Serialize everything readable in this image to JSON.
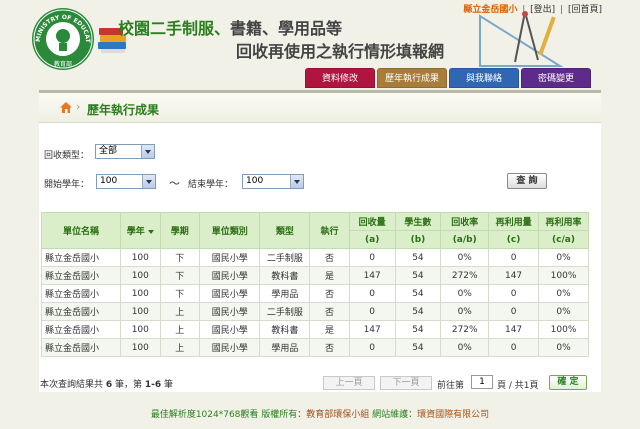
{
  "header": {
    "title_part1": "校園二手制服",
    "title_sep": "、",
    "title_part2": "書籍、學用品等",
    "title_line2": "回收再使用之執行情形填報網",
    "logo_icon": "ministry-of-education-seal",
    "logo_text": "MINISTRY OF EDUCATION",
    "logo_bottom": "教育部",
    "school_name": "縣立金岳國小",
    "logout_label": "[登出]",
    "separator": "|",
    "home_label": "[回首頁]"
  },
  "nav": {
    "items": [
      {
        "label": "資料修改",
        "color": "#b0153f"
      },
      {
        "label": "歷年執行成果",
        "color": "#a87d3a"
      },
      {
        "label": "與我聯絡",
        "color": "#2f67b5"
      },
      {
        "label": "密碼變更",
        "color": "#5e2b8a"
      }
    ]
  },
  "page": {
    "breadcrumb_icon": "home-icon",
    "title": "歷年執行成果"
  },
  "filters": {
    "category_label": "回收類型：",
    "category_value": "全部",
    "start_label": "開始學年：",
    "start_value": "100",
    "tilde": "～",
    "end_label": "結束學年：",
    "end_value": "100",
    "search_label": "查 詢"
  },
  "table": {
    "headers": [
      "單位名稱",
      "學年",
      "學期",
      "單位類別",
      "類型",
      "執行",
      "回收量",
      "學生數",
      "回收率",
      "再利用量",
      "再利用率"
    ],
    "subheaders": [
      "(a)",
      "(b)",
      "(a/b)",
      "(c)",
      "(c/a)"
    ],
    "rows": [
      [
        "縣立金岳國小",
        "100",
        "下",
        "國民小學",
        "二手制服",
        "否",
        "0",
        "54",
        "0%",
        "0",
        "0%"
      ],
      [
        "縣立金岳國小",
        "100",
        "下",
        "國民小學",
        "教科書",
        "是",
        "147",
        "54",
        "272%",
        "147",
        "100%"
      ],
      [
        "縣立金岳國小",
        "100",
        "下",
        "國民小學",
        "學用品",
        "否",
        "0",
        "54",
        "0%",
        "0",
        "0%"
      ],
      [
        "縣立金岳國小",
        "100",
        "上",
        "國民小學",
        "二手制服",
        "否",
        "0",
        "54",
        "0%",
        "0",
        "0%"
      ],
      [
        "縣立金岳國小",
        "100",
        "上",
        "國民小學",
        "教科書",
        "是",
        "147",
        "54",
        "272%",
        "147",
        "100%"
      ],
      [
        "縣立金岳國小",
        "100",
        "上",
        "國民小學",
        "學用品",
        "否",
        "0",
        "54",
        "0%",
        "0",
        "0%"
      ]
    ]
  },
  "pagination": {
    "summary_prefix": "本次查詢結果共 ",
    "total": "6",
    "summary_mid": " 筆，第 ",
    "range": "1-6",
    "summary_suffix": " 筆",
    "prev_label": "上一頁",
    "next_label": "下一頁",
    "goto_prefix": "前往第",
    "page_value": "1",
    "goto_suffix": "頁 / 共1頁",
    "confirm_label": "確 定"
  },
  "footer": {
    "part1": "最佳解析度1024*768觀看 版權所有：",
    "owner": "教育部環保小組",
    "part2": " 網站維護：",
    "maintainer": "環資國際有限公司"
  }
}
